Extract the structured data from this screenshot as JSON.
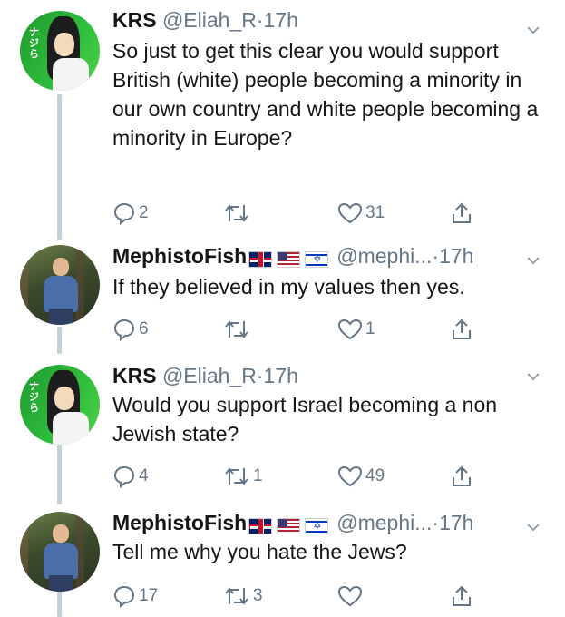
{
  "tweets": [
    {
      "name": "KRS",
      "handle": "@Eliah_R",
      "time": "17h",
      "text": "So just to get this clear you would support British (white) people becoming a minority in our own country and white people becoming a minority in Europe?",
      "replies": "2",
      "retweets": "",
      "likes": "31",
      "avatar": "anime-girl-avatar"
    },
    {
      "name": "MephistoFish",
      "handle": "@mephi...",
      "time": "17h",
      "flags": [
        "flag-uk",
        "flag-us",
        "flag-israel"
      ],
      "text": "If they believed in my values then yes.",
      "replies": "6",
      "retweets": "",
      "likes": "1",
      "avatar": "man-outdoors-avatar"
    },
    {
      "name": "KRS",
      "handle": "@Eliah_R",
      "time": "17h",
      "text": "Would you support Israel becoming a non Jewish state?",
      "replies": "4",
      "retweets": "1",
      "likes": "49",
      "avatar": "anime-girl-avatar"
    },
    {
      "name": "MephistoFish",
      "handle": "@mephi...",
      "time": "17h",
      "flags": [
        "flag-uk",
        "flag-us",
        "flag-israel"
      ],
      "text": "Tell me why you hate the Jews?",
      "replies": "17",
      "retweets": "3",
      "likes": "",
      "avatar": "man-outdoors-avatar"
    }
  ],
  "separator": "·",
  "icons": {
    "reply": "reply-icon",
    "retweet": "retweet-icon",
    "like": "heart-icon",
    "share": "share-icon",
    "menu": "chevron-down-icon"
  },
  "colors": {
    "text": "#14171a",
    "secondary": "#657786",
    "thread_line": "#c4cfd6"
  }
}
